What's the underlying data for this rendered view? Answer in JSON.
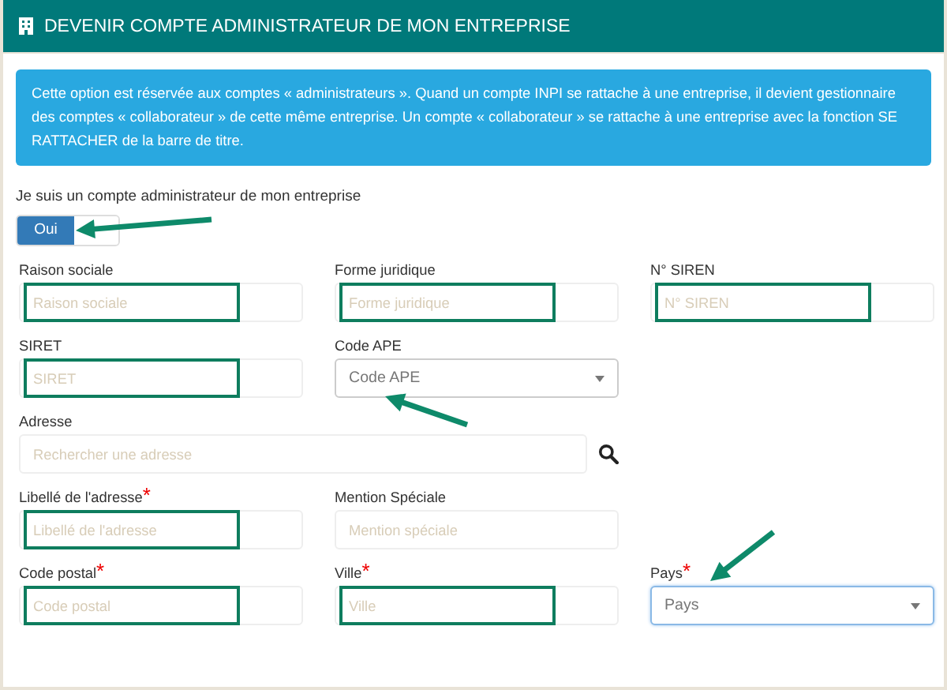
{
  "panel": {
    "title": "DEVENIR COMPTE ADMINISTRATEUR DE MON ENTREPRISE"
  },
  "info": "Cette option est réservée aux comptes « administrateurs ». Quand un compte INPI se rattache à une entreprise, il devient gestionnaire des comptes « collaborateur » de cette même entreprise. Un compte « collaborateur » se rattache à une entreprise avec la fonction SE RATTACHER de la barre de titre.",
  "toggle": {
    "label": "Je suis un compte administrateur de mon entreprise",
    "value": "Oui",
    "on": true,
    "arrow": {
      "kind": "left"
    }
  },
  "rows": [
    [
      {
        "kind": "input",
        "label": "Raison sociale",
        "placeholder": "Raison sociale",
        "highlighted": true
      },
      {
        "kind": "input",
        "label": "Forme juridique",
        "placeholder": "Forme juridique",
        "highlighted": true
      },
      {
        "kind": "input",
        "label": "N° SIREN",
        "placeholder": "N° SIREN",
        "highlighted": true
      }
    ],
    [
      {
        "kind": "input",
        "label": "SIRET",
        "placeholder": "SIRET",
        "highlighted": true
      },
      {
        "kind": "select",
        "label": "Code APE",
        "placeholder": "Code APE",
        "highlighted": false,
        "arrow": {
          "kind": "up-left"
        }
      }
    ],
    [
      {
        "kind": "search",
        "label": "Adresse",
        "placeholder": "Rechercher une adresse",
        "highlighted": false
      }
    ],
    [
      {
        "kind": "input",
        "label": "Libellé de l'adresse",
        "required_mark": "*",
        "placeholder": "Libellé de l'adresse",
        "highlighted": true
      },
      {
        "kind": "input",
        "label": "Mention Spéciale",
        "placeholder": "Mention spéciale",
        "highlighted": false
      }
    ],
    [
      {
        "kind": "input",
        "label": "Code postal",
        "required_mark": "*",
        "placeholder": "Code postal",
        "highlighted": true
      },
      {
        "kind": "input",
        "label": "Ville",
        "required_mark": "*",
        "placeholder": "Ville",
        "highlighted": true
      },
      {
        "kind": "select",
        "label": "Pays",
        "required_mark": "*",
        "placeholder": "Pays",
        "highlighted": false,
        "focused": true,
        "arrow": {
          "kind": "down-left"
        }
      }
    ]
  ]
}
